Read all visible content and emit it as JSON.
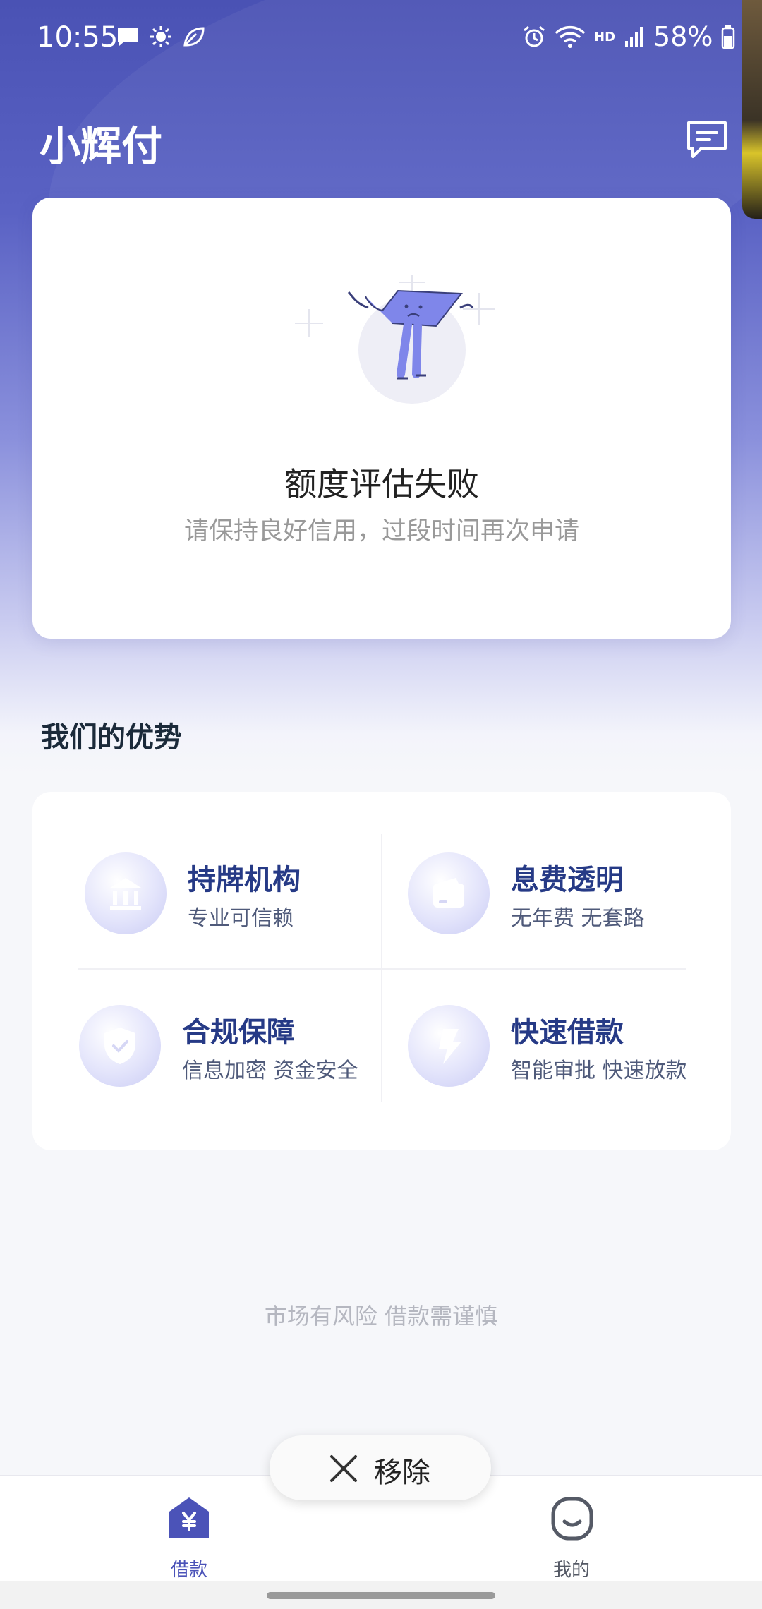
{
  "status_bar": {
    "time": "10:55",
    "battery": "58%",
    "network": "HD"
  },
  "app": {
    "title": "小辉付"
  },
  "result": {
    "title": "额度评估失败",
    "subtitle": "请保持良好信用，过段时间再次申请"
  },
  "advantages": {
    "section_title": "我们的优势",
    "items": [
      {
        "title": "持牌机构",
        "subtitle": "专业可信赖",
        "icon": "bank-icon"
      },
      {
        "title": "息费透明",
        "subtitle": "无年费 无套路",
        "icon": "wallet-icon"
      },
      {
        "title": "合规保障",
        "subtitle": "信息加密 资金安全",
        "icon": "shield-icon"
      },
      {
        "title": "快速借款",
        "subtitle": "智能审批 快速放款",
        "icon": "lightning-icon"
      }
    ]
  },
  "risk_notice": "市场有风险 借款需谨慎",
  "toast": {
    "label": "移除"
  },
  "tabs": [
    {
      "label": "借款",
      "active": true,
      "icon": "yen-tag-icon"
    },
    {
      "label": "我的",
      "active": false,
      "icon": "smile-face-icon"
    }
  ],
  "colors": {
    "primary": "#4b53b8",
    "accent_title": "#263a86",
    "active_tab": "#4b53b8",
    "inactive_tab": "#555a66"
  }
}
